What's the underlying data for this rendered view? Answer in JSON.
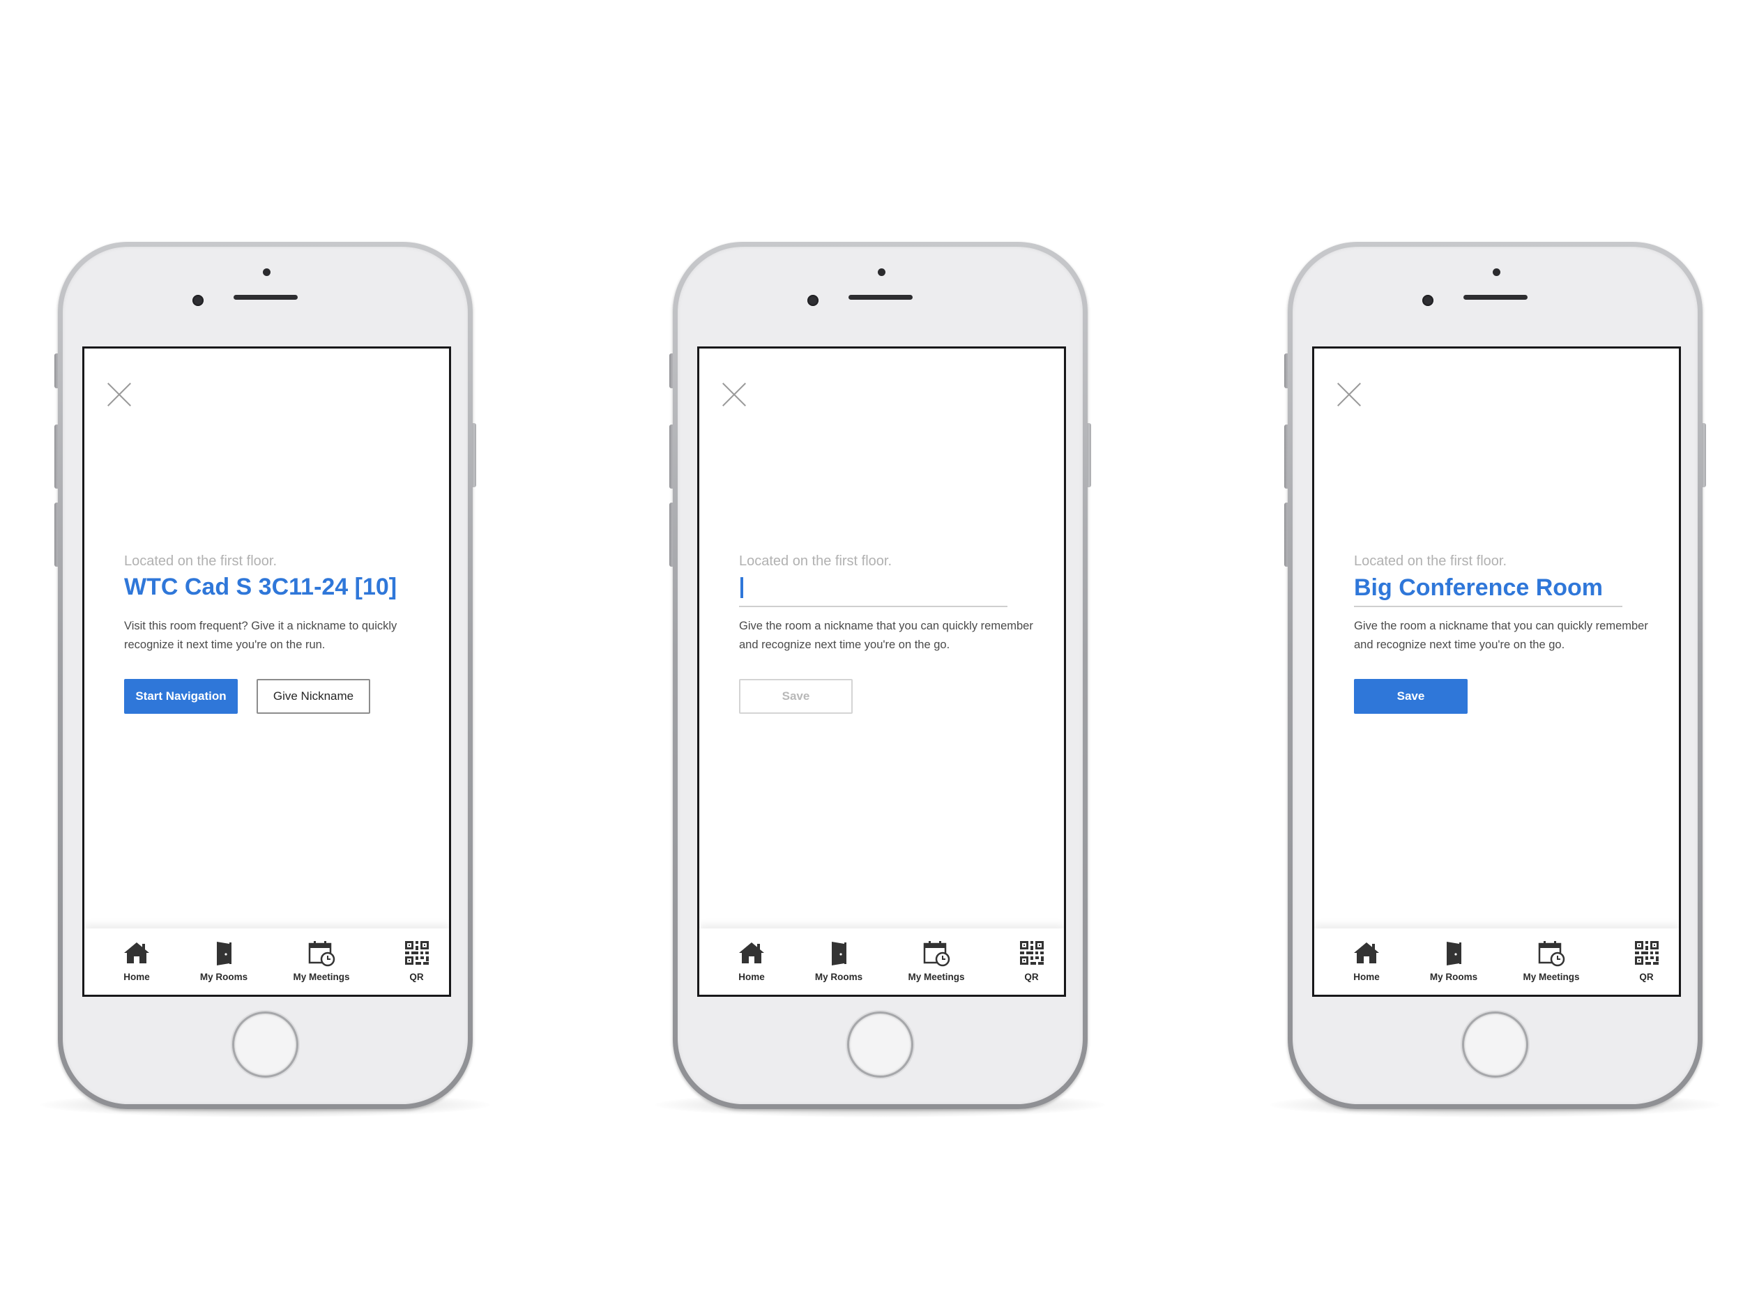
{
  "phones": [
    {
      "location": "Located on the first floor.",
      "title": "WTC Cad S 3C11-24 [10]",
      "description": "Visit this room frequent? Give it a nickname to quickly recognize it next time you're on the run.",
      "primary_button": "Start Navigation",
      "secondary_button": "Give Nickname"
    },
    {
      "location": "Located on the first floor.",
      "nickname_input": "",
      "description": "Give the room a nickname that you can quickly remember and recognize next time you're on the go.",
      "save_button": "Save",
      "save_state": "disabled"
    },
    {
      "location": "Located on the first floor.",
      "nickname_input": "Big Conference Room",
      "description": "Give the room a nickname that you can quickly remember and recognize next time you're on the go.",
      "save_button": "Save",
      "save_state": "enabled"
    }
  ],
  "tabbar": {
    "items": [
      {
        "label": "Home",
        "icon": "home-icon"
      },
      {
        "label": "My Rooms",
        "icon": "door-icon"
      },
      {
        "label": "My Meetings",
        "icon": "calendar-clock-icon"
      },
      {
        "label": "QR",
        "icon": "qr-code-icon"
      }
    ]
  },
  "colors": {
    "accent": "#2f77d9",
    "muted_text": "#b1b1b1",
    "body_text": "#4a4a4a",
    "disabled": "#d4d4d4"
  }
}
